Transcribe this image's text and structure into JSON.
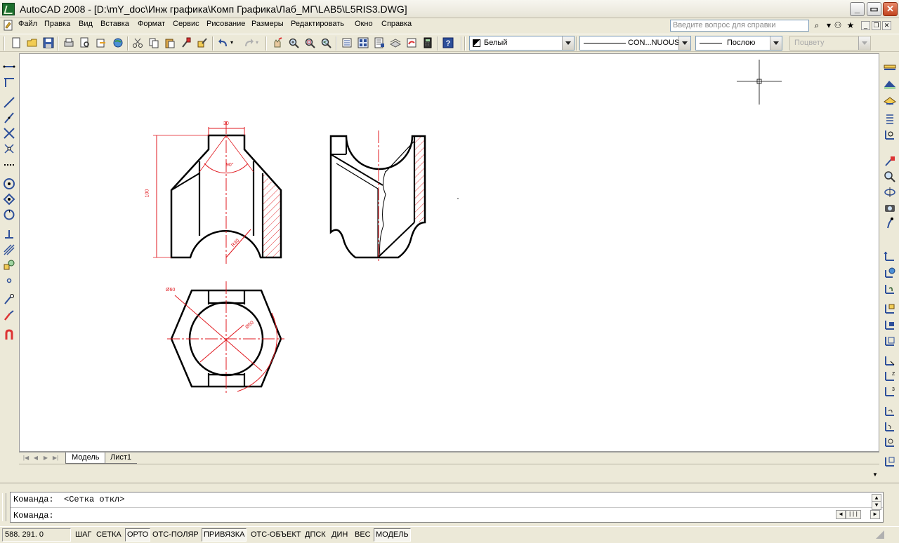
{
  "titlebar": {
    "title": "AutoCAD 2008 - [D:\\mY_doc\\Инж графика\\Комп Графика\\Лаб_МГ\\LAB5\\L5RIS3.DWG]",
    "minimize": "_",
    "maximize": "▭",
    "close": "✕"
  },
  "menu": {
    "items": [
      "Файл",
      "Правка",
      "Вид",
      "Вставка",
      "Формат",
      "Сервис",
      "Рисование",
      "Размеры",
      "Редактировать",
      "Окно",
      "Справка"
    ],
    "help_placeholder": "Введите вопрос для справки"
  },
  "toolbar": {
    "color_combo": "Белый",
    "linetype_combo": "CON...NUOUS",
    "lineweight_combo": "Послою",
    "plotstyle_combo": "Поцвету"
  },
  "drawing": {
    "dim_width": "30",
    "dim_angle": "90°",
    "dim_height": "100",
    "dim_radius": "R30",
    "dim_hex": "Ø60",
    "dim_circle": "Ø50"
  },
  "tabs": {
    "model": "Модель",
    "sheet1": "Лист1"
  },
  "command": {
    "line1": "Команда:  <Сетка откл>",
    "line2": "Команда:"
  },
  "status": {
    "coords": "588. 291. 0",
    "buttons": [
      {
        "label": "ШАГ",
        "on": false
      },
      {
        "label": "СЕТКА",
        "on": false
      },
      {
        "label": "ОРТО",
        "on": true
      },
      {
        "label": "ОТС-ПОЛЯР",
        "on": false
      },
      {
        "label": "ПРИВЯЗКА",
        "on": true
      },
      {
        "label": "ОТС-ОБЪЕКТ",
        "on": false
      },
      {
        "label": "ДПСК",
        "on": false
      },
      {
        "label": "ДИН",
        "on": false
      },
      {
        "label": "ВЕС",
        "on": false
      },
      {
        "label": "МОДЕЛЬ",
        "on": true
      }
    ]
  },
  "colors": {
    "dimension": "#e0191f",
    "geometry": "#000000",
    "canvas": "#ffffff"
  }
}
